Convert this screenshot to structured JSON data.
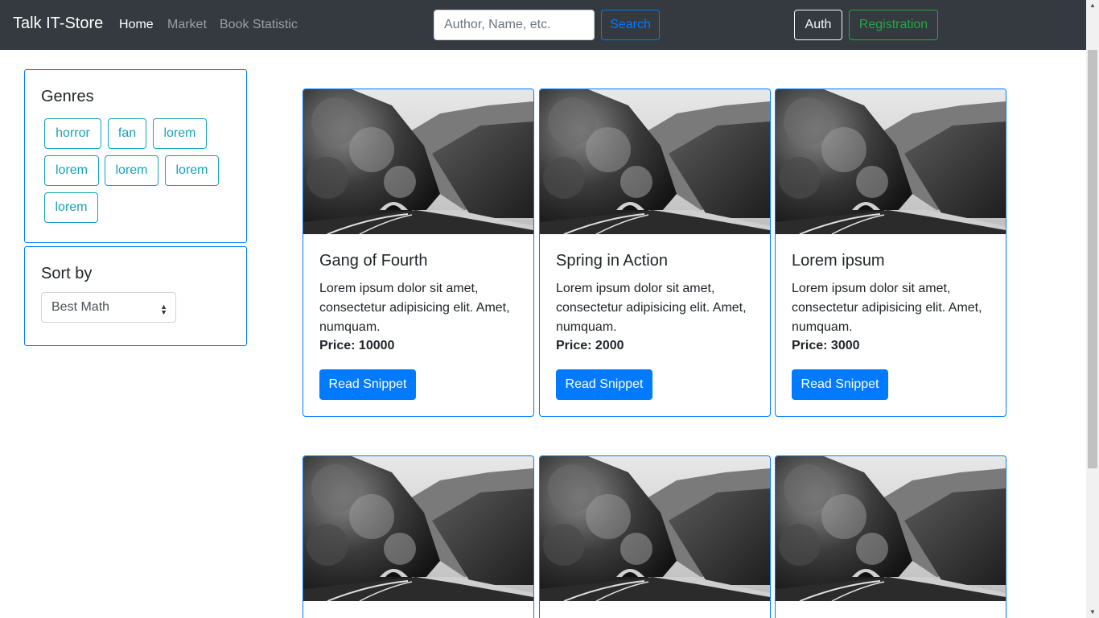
{
  "navbar": {
    "brand": "Talk IT-Store",
    "links": [
      {
        "label": "Home",
        "active": true
      },
      {
        "label": "Market",
        "active": false
      },
      {
        "label": "Book Statistic",
        "active": false
      }
    ],
    "search": {
      "placeholder": "Author, Name, etc.",
      "value": "",
      "button_label": "Search"
    },
    "auth_label": "Auth",
    "registration_label": "Registration"
  },
  "sidebar": {
    "genres_title": "Genres",
    "genres": [
      "horror",
      "fan",
      "lorem",
      "lorem",
      "lorem",
      "lorem",
      "lorem"
    ],
    "sort_title": "Sort by",
    "sort_selected": "Best Math"
  },
  "books": [
    {
      "title": "Gang of Fourth",
      "description": "Lorem ipsum dolor sit amet, consectetur adipisicing elit. Amet, numquam.",
      "price_label": "Price: 10000",
      "button_label": "Read Snippet"
    },
    {
      "title": "Spring in Action",
      "description": "Lorem ipsum dolor sit amet, consectetur adipisicing elit. Amet, numquam.",
      "price_label": "Price: 2000",
      "button_label": "Read Snippet"
    },
    {
      "title": "Lorem ipsum",
      "description": "Lorem ipsum dolor sit amet, consectetur adipisicing elit. Amet, numquam.",
      "price_label": "Price: 3000",
      "button_label": "Read Snippet"
    }
  ],
  "colors": {
    "navbar_bg": "#343a40",
    "primary": "#007bff",
    "info": "#17a2b8",
    "success": "#28a745"
  },
  "icons": {
    "image": "mountain-road-tunnel-photo",
    "select": "select-caret-icon"
  }
}
